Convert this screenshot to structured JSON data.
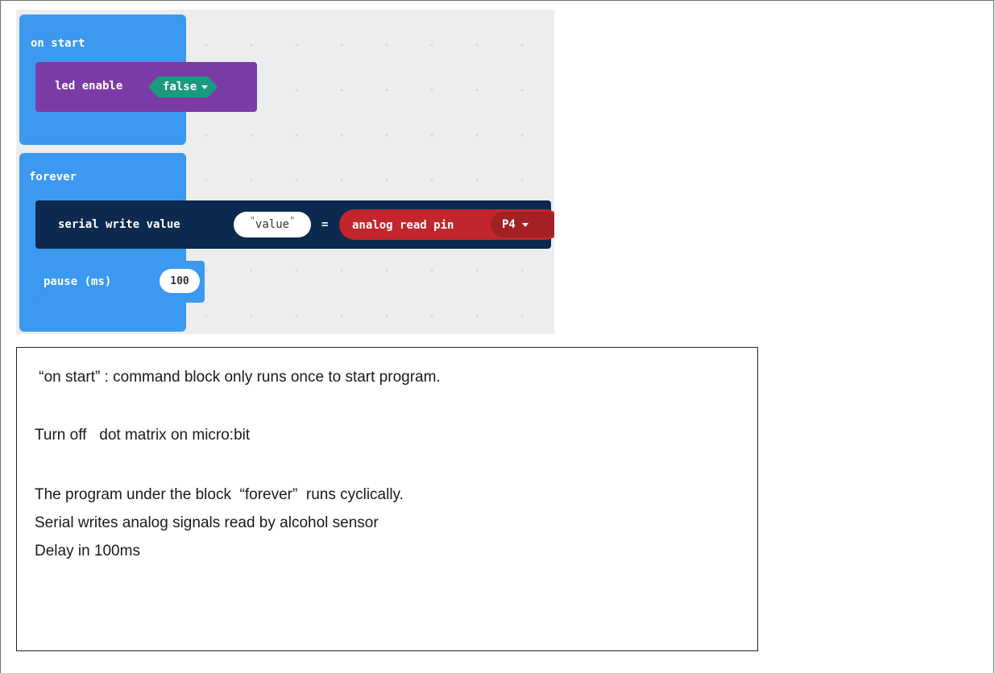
{
  "blocks": {
    "on_start": {
      "header": "on start",
      "led_enable_label": "led enable",
      "led_enable_value": "false"
    },
    "forever": {
      "header": "forever",
      "serial_label": "serial write value",
      "serial_name": "value",
      "equals": "=",
      "analog_label": "analog read pin",
      "pin_value": "P4",
      "pause_label": "pause (ms)",
      "pause_value": "100"
    }
  },
  "notes": {
    "line1": " “on start” : command block only runs once to start program.",
    "line2": "Turn off   dot matrix on micro:bit",
    "line3": "The program under the block  “forever”  runs cyclically.",
    "line4": "Serial writes analog signals read by alcohol sensor",
    "line5": "Delay in 100ms"
  },
  "colors": {
    "workspace_bg": "#ecedee",
    "basic_blue": "#3b99f0",
    "led_purple": "#7b3ba6",
    "logic_teal": "#1a9a7f",
    "serial_navy": "#0c2a4f",
    "pins_red": "#c0262b"
  },
  "icons": [
    "dropdown-caret-icon"
  ]
}
